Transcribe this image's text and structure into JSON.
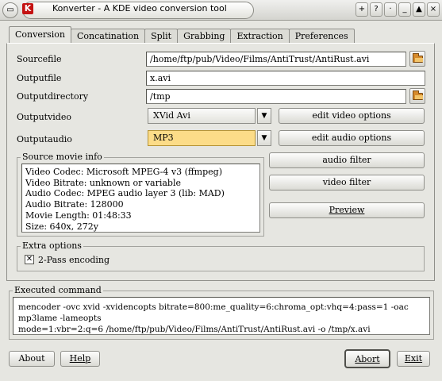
{
  "window": {
    "title": "Konverter - A KDE video conversion tool",
    "app_icon_letter": "K",
    "controls": [
      "+",
      "?",
      "·",
      "_",
      "▲",
      "×"
    ]
  },
  "tabs": [
    {
      "label": "Conversion",
      "active": true
    },
    {
      "label": "Concatination",
      "active": false
    },
    {
      "label": "Split",
      "active": false
    },
    {
      "label": "Grabbing",
      "active": false
    },
    {
      "label": "Extraction",
      "active": false
    },
    {
      "label": "Preferences",
      "active": false
    }
  ],
  "form": {
    "sourcefile_label": "Sourcefile",
    "sourcefile_value": "/home/ftp/pub/Video/Films/AntiTrust/AntiRust.avi",
    "outputfile_label": "Outputfile",
    "outputfile_value": "x.avi",
    "outputdirectory_label": "Outputdirectory",
    "outputdirectory_value": "/tmp",
    "outputvideo_label": "Outputvideo",
    "outputvideo_value": "XVid Avi",
    "outputaudio_label": "Outputaudio",
    "outputaudio_value": "MP3"
  },
  "buttons": {
    "edit_video_options": "edit video options",
    "edit_audio_options": "edit audio options",
    "audio_filter": "audio filter",
    "video_filter": "video filter",
    "preview": "Preview",
    "about": "About",
    "help": "Help",
    "abort": "Abort",
    "exit": "Exit"
  },
  "source_info": {
    "title": "Source movie info",
    "lines": [
      "Video Codec: Microsoft MPEG-4 v3 (ffmpeg)",
      "Video Bitrate: unknown or variable",
      "Audio Codec: MPEG audio layer 3 (lib: MAD)",
      "Audio Bitrate: 128000",
      "Movie Length: 01:48:33",
      "Size: 640x, 272y"
    ]
  },
  "extra_options": {
    "title": "Extra options",
    "two_pass_label": "2-Pass encoding",
    "two_pass_checked": true,
    "check_mark": "✕"
  },
  "executed_command": {
    "title": "Executed command",
    "line1": "mencoder -ovc xvid -xvidencopts bitrate=800:me_quality=6:chroma_opt:vhq=4:pass=1 -oac mp3lame -lameopts",
    "line2": "mode=1:vbr=2:q=6 /home/ftp/pub/Video/Films/AntiTrust/AntiRust.avi -o /tmp/x.avi"
  }
}
